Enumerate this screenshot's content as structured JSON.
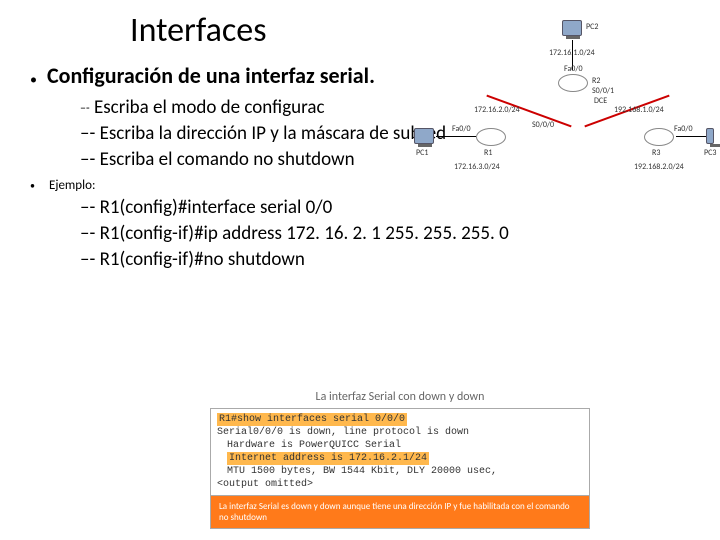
{
  "title": "Interfaces",
  "main_bullet": "Configuración de una interfaz serial.",
  "sub": [
    "Escriba el modo de configurac",
    "Escriba la dirección IP y la máscara de subred",
    "Escriba el comando no shutdown"
  ],
  "example_label": "Ejemplo:",
  "example": [
    "R1(config)#interface serial 0/0",
    "R1(config-if)#ip address 172. 16. 2. 1 255. 255. 255. 0",
    "R1(config-if)#no shutdown"
  ],
  "topology": {
    "pc2": "PC2",
    "ip_top": "172.16.1.0/24",
    "fa00a": "Fa0/0",
    "r2": "R2",
    "s001": "S0/0/1",
    "dce": "DCE",
    "left_net": "172.16.2.0/24",
    "right_net": "192.168.1.0/24",
    "s000": "S0/0/0",
    "pc1": "PC1",
    "fa00b": "Fa0/0",
    "r1": "R1",
    "r3": "R3",
    "fa00c": "Fa0/0",
    "pc3": "PC3",
    "bottom_left": "172.16.3.0/24",
    "bottom_right": "192.168.2.0/24"
  },
  "terminal": {
    "caption": "La interfaz Serial con down y down",
    "cmd": "R1#show interfaces serial 0/0/0",
    "line1": "Serial0/0/0 is down, line protocol is down",
    "line2": "Hardware is PowerQUICC Serial",
    "line3": "Internet address is 172.16.2.1/24",
    "line4": "MTU 1500 bytes, BW 1544 Kbit, DLY 20000 usec,",
    "line5": "<output omitted>",
    "footer": "La interfaz Serial es down y down aunque tiene una dirección IP y fue habilitada con el comando no shutdown"
  }
}
